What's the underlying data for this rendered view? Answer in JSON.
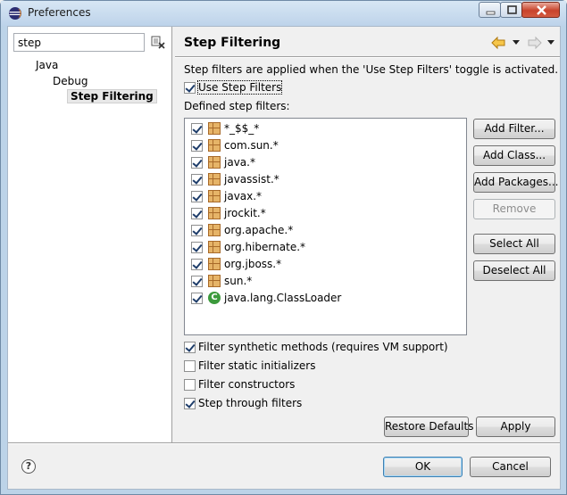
{
  "window": {
    "title": "Preferences"
  },
  "filter": {
    "value": "step"
  },
  "tree": {
    "items": [
      {
        "label": "Java"
      },
      {
        "label": "Debug"
      },
      {
        "label": "Step Filtering"
      }
    ]
  },
  "page": {
    "title": "Step Filtering",
    "description": "Step filters are applied when the 'Use Step Filters' toggle is activated.",
    "use_step_filters": {
      "label": "Use Step Filters",
      "checked": true
    },
    "defined_label": "Defined step filters:",
    "filters": [
      {
        "text": "*_$$_*",
        "icon": "package-icon",
        "checked": true
      },
      {
        "text": "com.sun.*",
        "icon": "package-icon",
        "checked": true
      },
      {
        "text": "java.*",
        "icon": "package-icon",
        "checked": true
      },
      {
        "text": "javassist.*",
        "icon": "package-icon",
        "checked": true
      },
      {
        "text": "javax.*",
        "icon": "package-icon",
        "checked": true
      },
      {
        "text": "jrockit.*",
        "icon": "package-icon",
        "checked": true
      },
      {
        "text": "org.apache.*",
        "icon": "package-icon",
        "checked": true
      },
      {
        "text": "org.hibernate.*",
        "icon": "package-icon",
        "checked": true
      },
      {
        "text": "org.jboss.*",
        "icon": "package-icon",
        "checked": true
      },
      {
        "text": "sun.*",
        "icon": "package-icon",
        "checked": true
      },
      {
        "text": "java.lang.ClassLoader",
        "icon": "class-icon",
        "checked": true
      }
    ],
    "buttons": {
      "add_filter": "Add Filter...",
      "add_class": "Add Class...",
      "add_packages": "Add Packages...",
      "remove": "Remove",
      "select_all": "Select All",
      "deselect_all": "Deselect All"
    },
    "options": [
      {
        "label": "Filter synthetic methods (requires VM support)",
        "checked": true
      },
      {
        "label": "Filter static initializers",
        "checked": false
      },
      {
        "label": "Filter constructors",
        "checked": false
      },
      {
        "label": "Step through filters",
        "checked": true
      }
    ],
    "restore_defaults": "Restore Defaults",
    "apply": "Apply"
  },
  "dialog": {
    "ok": "OK",
    "cancel": "Cancel",
    "help_glyph": "?"
  },
  "colors": {
    "accent": "#3c7fb1",
    "package_icon": "#e6b468",
    "class_icon": "#3c9a3c",
    "close_button": "#c8432b"
  }
}
